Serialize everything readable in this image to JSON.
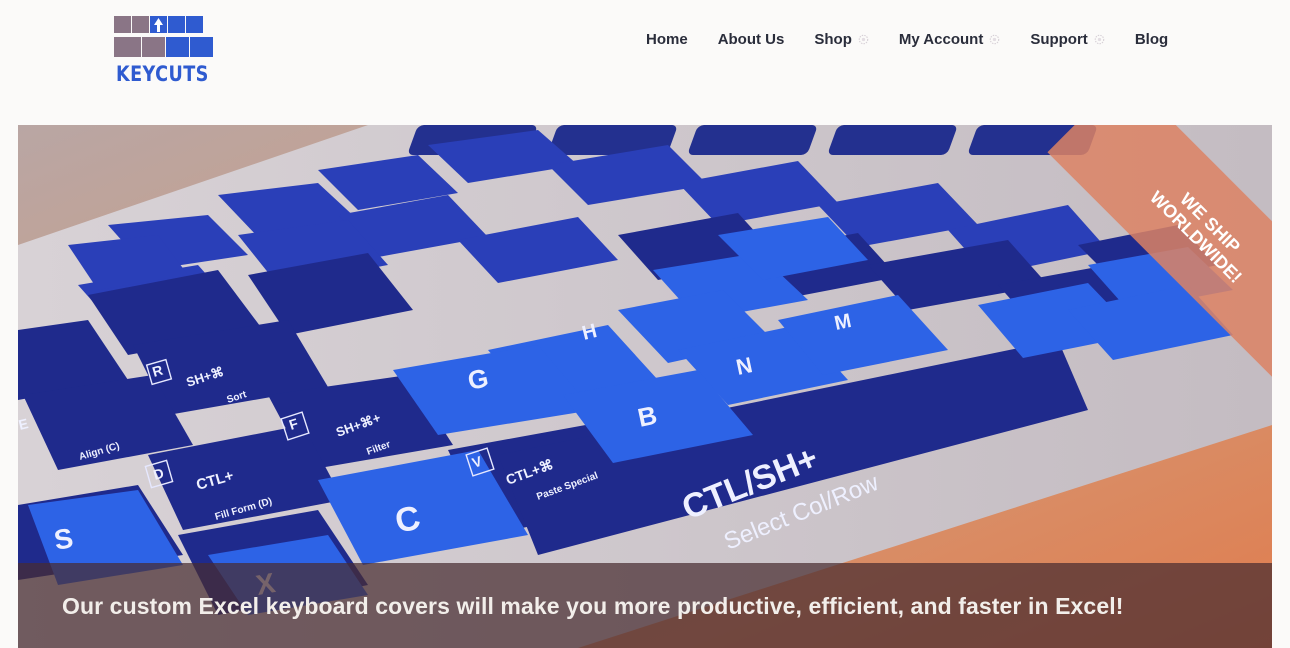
{
  "brand": {
    "name": "KEYCUTS"
  },
  "nav": {
    "home": "Home",
    "about": "About Us",
    "shop": "Shop",
    "account": "My Account",
    "support": "Support",
    "blog": "Blog"
  },
  "hero": {
    "ribbon_line1": "WE SHIP",
    "ribbon_line2": "WORLDWIDE!",
    "caption": "Our custom Excel keyboard covers will make you more productive, efficient, and faster in Excel!",
    "keys": {
      "g": "G",
      "h": "H",
      "b": "B",
      "n": "N",
      "m": "M",
      "c": "C",
      "s": "S",
      "x": "X",
      "ctl_sh_big": "CTL/SH+",
      "select_col_row": "Select Col/Row",
      "ctl_d": "CTL+",
      "fill_form": "Fill Form (D)",
      "v_letter": "V",
      "ctl_cmd": "CTL+⌘",
      "paste_special": "Paste Special",
      "f_letter": "F",
      "sh_cmd_filter": "SH+⌘+",
      "filter": "Filter",
      "r_letter": "R",
      "sh_cmd_sort": "SH+⌘",
      "sort": "Sort",
      "d_letter": "D",
      "e_letter": "E",
      "align": "Align (C)"
    }
  },
  "colors": {
    "brand_blue": "#2f5bd0",
    "key_dark": "#202a8c",
    "key_bright": "#2d63e6",
    "keyboard_frame": "#c7c2c8",
    "hero_bg": "#c98a66"
  },
  "icons": {
    "logo": "keycuts-logo-icon",
    "caret": "chevron-down-icon"
  }
}
